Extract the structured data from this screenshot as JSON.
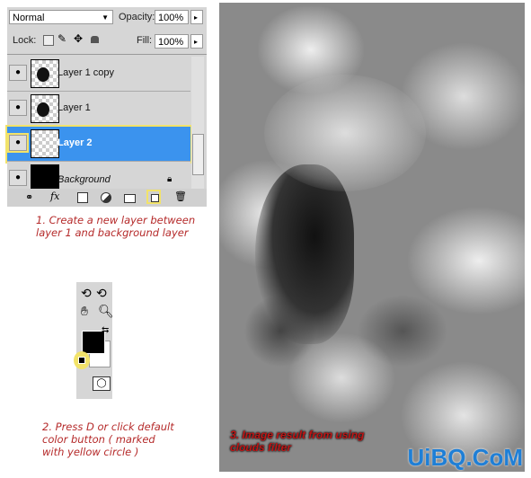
{
  "layers_panel": {
    "blend_mode": "Normal",
    "opacity_label": "Opacity:",
    "opacity": "100%",
    "lock_label": "Lock:",
    "fill_label": "Fill:",
    "fill": "100%",
    "layers": [
      {
        "name": "Layer 1 copy",
        "selected": false
      },
      {
        "name": "Layer 1",
        "selected": false
      },
      {
        "name": "Layer 2",
        "selected": true
      },
      {
        "name": "Background",
        "selected": false
      }
    ],
    "footer_icons": [
      "link-icon",
      "fx-icon",
      "mask-icon",
      "adjustment-icon",
      "folder-icon",
      "new-layer-icon",
      "trash-icon"
    ]
  },
  "notes": {
    "step1": "1. Create a new layer between layer 1 and background layer",
    "step2": "2. Press D or click default color button ( marked with yellow circle )",
    "step3": "3. Image result from using clouds filter"
  },
  "watermark": "UiBQ.CoM",
  "colors": {
    "selection": "#3b93ee",
    "highlight": "#f2e36a",
    "note": "#b52a2a"
  }
}
